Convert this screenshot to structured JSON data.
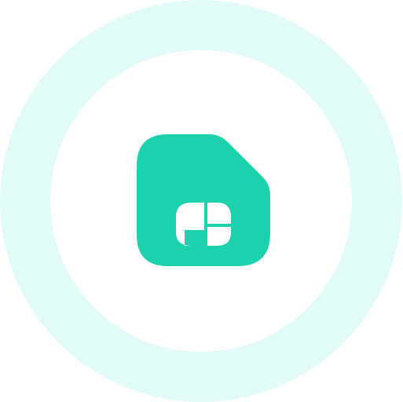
{
  "colors": {
    "background": "#ffffff",
    "ring": "#e3fbf8",
    "icon_fill": "#1cd2ad",
    "icon_symbol": "#ffffff"
  },
  "icon": {
    "name": "sim-card-icon"
  }
}
